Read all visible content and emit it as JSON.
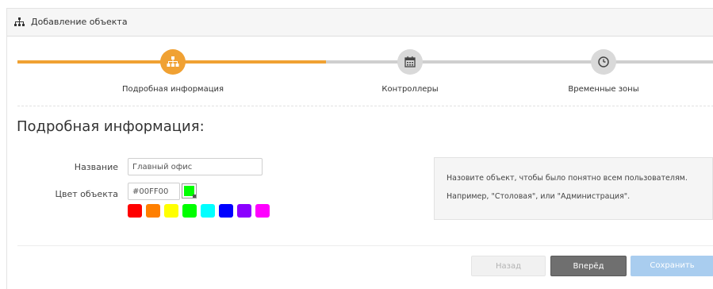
{
  "header": {
    "title": "Добавление объекта",
    "icon": "sitemap-icon"
  },
  "steps": [
    {
      "label": "Подробная информация",
      "icon": "sitemap-icon",
      "active": true
    },
    {
      "label": "Контроллеры",
      "icon": "calendar-icon",
      "active": false
    },
    {
      "label": "Временные зоны",
      "icon": "clock-icon",
      "active": false
    }
  ],
  "progress": {
    "completed_steps": 1,
    "total_steps": 3
  },
  "section_title": "Подробная информация:",
  "form": {
    "name_label": "Название",
    "name_value": "Главный офис",
    "color_label": "Цвет объекта",
    "color_value": "#00FF00"
  },
  "palette": [
    "#ff0000",
    "#ff7f00",
    "#ffff00",
    "#00ff00",
    "#00ffff",
    "#0000ff",
    "#8b00ff",
    "#ff00ff"
  ],
  "help": {
    "line1": "Назовите объект, чтобы было понятно всем пользователям.",
    "line2": "Например, \"Столовая\", или \"Администрация\"."
  },
  "buttons": {
    "back": "Назад",
    "next": "Вперёд",
    "save": "Сохранить"
  },
  "colors": {
    "accent": "#f0a133",
    "inactive_step": "#d9d9d9",
    "next_button": "#6f6f6f",
    "save_button": "#a9cdef"
  }
}
